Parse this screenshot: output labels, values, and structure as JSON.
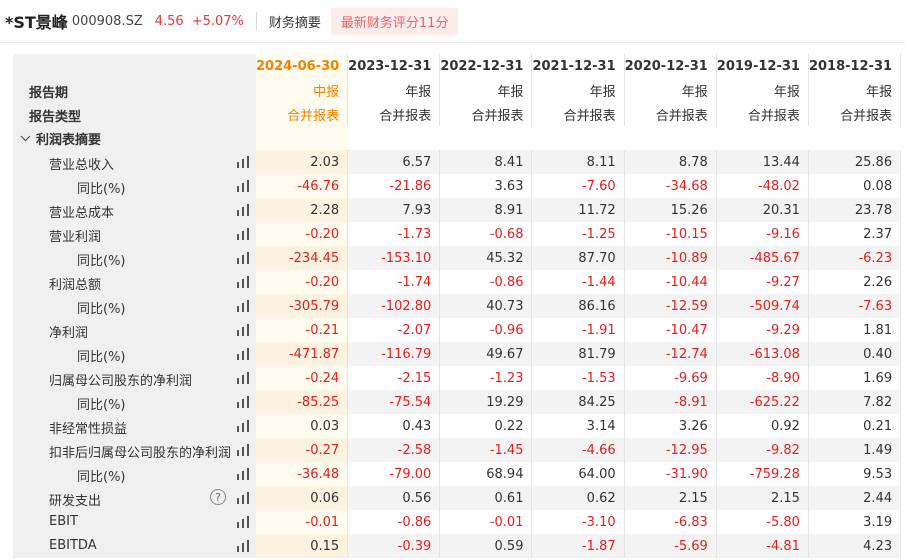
{
  "header": {
    "stock_name": "*ST景峰",
    "stock_code": "000908.SZ",
    "price": "4.56",
    "change": "+5.07%",
    "tab": "财务摘要",
    "score": "最新财务评分11分"
  },
  "table": {
    "period_label": "报告期",
    "type_label": "报告类型",
    "columns": [
      {
        "date": "2024-06-30",
        "period": "中报",
        "type": "合并报表"
      },
      {
        "date": "2023-12-31",
        "period": "年报",
        "type": "合并报表"
      },
      {
        "date": "2022-12-31",
        "period": "年报",
        "type": "合并报表"
      },
      {
        "date": "2021-12-31",
        "period": "年报",
        "type": "合并报表"
      },
      {
        "date": "2020-12-31",
        "period": "年报",
        "type": "合并报表"
      },
      {
        "date": "2019-12-31",
        "period": "年报",
        "type": "合并报表"
      },
      {
        "date": "2018-12-31",
        "period": "年报",
        "type": "合并报表"
      }
    ],
    "section_title": "利润表摘要",
    "rows": [
      {
        "label": "营业总收入",
        "level": 1,
        "values": [
          "2.03",
          "6.57",
          "8.41",
          "8.11",
          "8.78",
          "13.44",
          "25.86"
        ]
      },
      {
        "label": "同比(%)",
        "level": 2,
        "values": [
          "-46.76",
          "-21.86",
          "3.63",
          "-7.60",
          "-34.68",
          "-48.02",
          "0.08"
        ]
      },
      {
        "label": "营业总成本",
        "level": 1,
        "values": [
          "2.28",
          "7.93",
          "8.91",
          "11.72",
          "15.26",
          "20.31",
          "23.78"
        ]
      },
      {
        "label": "营业利润",
        "level": 1,
        "values": [
          "-0.20",
          "-1.73",
          "-0.68",
          "-1.25",
          "-10.15",
          "-9.16",
          "2.37"
        ]
      },
      {
        "label": "同比(%)",
        "level": 2,
        "values": [
          "-234.45",
          "-153.10",
          "45.32",
          "87.70",
          "-10.89",
          "-485.67",
          "-6.23"
        ]
      },
      {
        "label": "利润总额",
        "level": 1,
        "values": [
          "-0.20",
          "-1.74",
          "-0.86",
          "-1.44",
          "-10.44",
          "-9.27",
          "2.26"
        ]
      },
      {
        "label": "同比(%)",
        "level": 2,
        "values": [
          "-305.79",
          "-102.80",
          "40.73",
          "86.16",
          "-12.59",
          "-509.74",
          "-7.63"
        ]
      },
      {
        "label": "净利润",
        "level": 1,
        "values": [
          "-0.21",
          "-2.07",
          "-0.96",
          "-1.91",
          "-10.47",
          "-9.29",
          "1.81"
        ]
      },
      {
        "label": "同比(%)",
        "level": 2,
        "values": [
          "-471.87",
          "-116.79",
          "49.67",
          "81.79",
          "-12.74",
          "-613.08",
          "0.40"
        ]
      },
      {
        "label": "归属母公司股东的净利润",
        "level": 1,
        "values": [
          "-0.24",
          "-2.15",
          "-1.23",
          "-1.53",
          "-9.69",
          "-8.90",
          "1.69"
        ]
      },
      {
        "label": "同比(%)",
        "level": 2,
        "values": [
          "-85.25",
          "-75.54",
          "19.29",
          "84.25",
          "-8.91",
          "-625.22",
          "7.82"
        ]
      },
      {
        "label": "非经常性损益",
        "level": 1,
        "values": [
          "0.03",
          "0.43",
          "0.22",
          "3.14",
          "3.26",
          "0.92",
          "0.21"
        ]
      },
      {
        "label": "扣非后归属母公司股东的净利润",
        "level": 1,
        "values": [
          "-0.27",
          "-2.58",
          "-1.45",
          "-4.66",
          "-12.95",
          "-9.82",
          "1.49"
        ]
      },
      {
        "label": "同比(%)",
        "level": 2,
        "values": [
          "-36.48",
          "-79.00",
          "68.94",
          "64.00",
          "-31.90",
          "-759.28",
          "9.53"
        ]
      },
      {
        "label": "研发支出",
        "level": 1,
        "help": "?",
        "values": [
          "0.06",
          "0.56",
          "0.61",
          "0.62",
          "2.15",
          "2.15",
          "2.44"
        ]
      },
      {
        "label": "EBIT",
        "level": 1,
        "values": [
          "-0.01",
          "-0.86",
          "-0.01",
          "-3.10",
          "-6.83",
          "-5.80",
          "3.19"
        ]
      },
      {
        "label": "EBITDA",
        "level": 1,
        "values": [
          "0.15",
          "-0.39",
          "0.59",
          "-1.87",
          "-5.69",
          "-4.81",
          "4.23"
        ]
      }
    ]
  },
  "colors": {
    "accent": "#f08300",
    "negative": "#e02020",
    "positive": "#333333",
    "label_bg": "#f0f0f0",
    "stripe_bg": "#f3f3f3"
  }
}
